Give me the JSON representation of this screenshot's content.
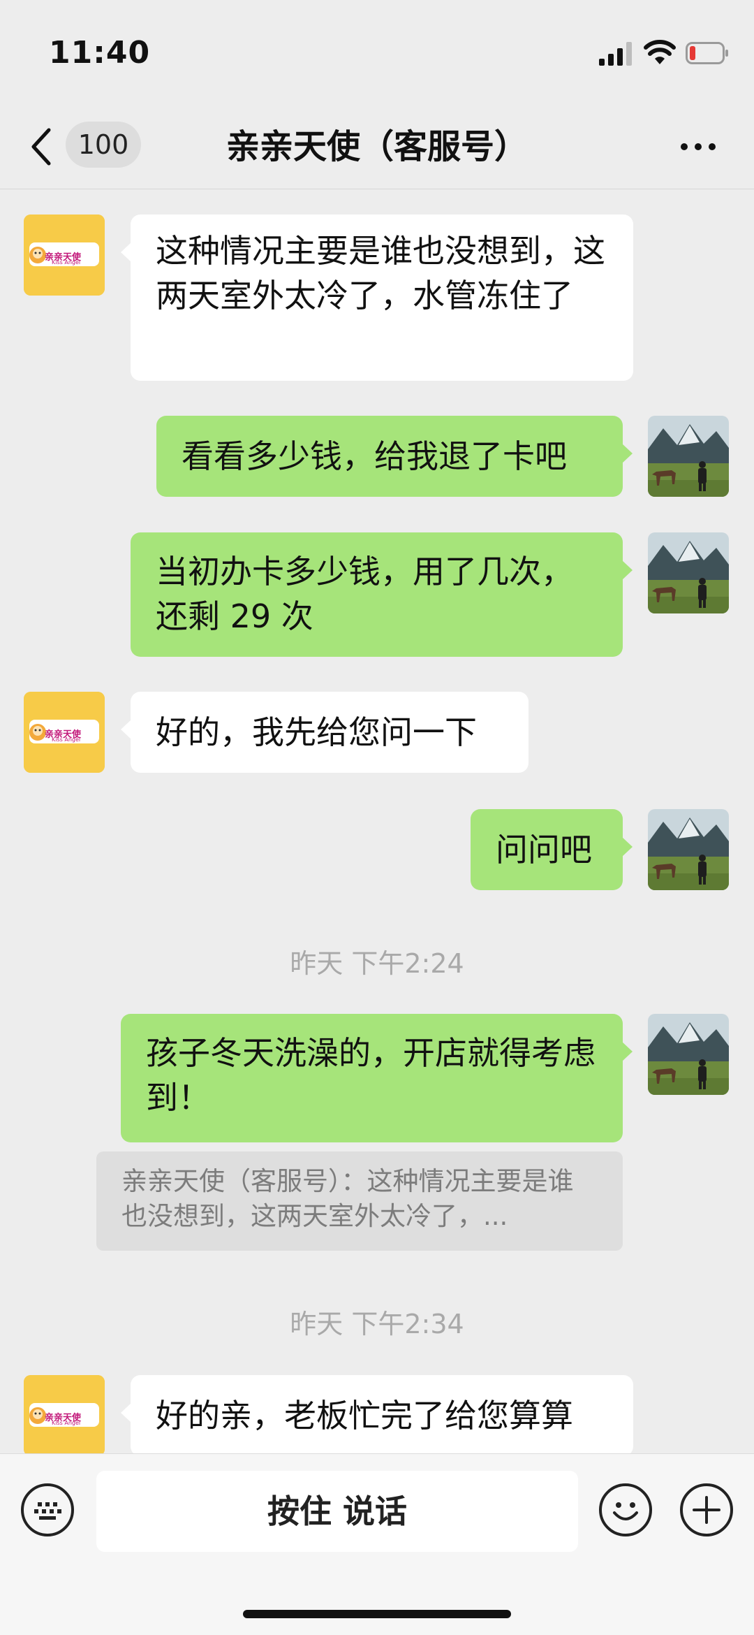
{
  "status_bar": {
    "time": "11:40"
  },
  "nav": {
    "unread_count": "100",
    "title": "亲亲天使（客服号）"
  },
  "brand_logo": {
    "text_cn": "亲亲天使",
    "text_en": "Kiss Angel"
  },
  "messages": [
    {
      "side": "left",
      "text": "这种情况主要是谁也没想到，这两天室外太冷了，水管冻住了"
    },
    {
      "side": "right",
      "text": "看看多少钱，给我退了卡吧"
    },
    {
      "side": "right",
      "text": "当初办卡多少钱，用了几次，还剩 29 次"
    },
    {
      "side": "left",
      "text": "好的，我先给您问一下"
    },
    {
      "side": "right",
      "text": "问问吧"
    },
    {
      "side": "right",
      "text": "孩子冬天洗澡的，开店就得考虑到！"
    },
    {
      "side": "left",
      "text": "好的亲，老板忙完了给您算算"
    }
  ],
  "timestamps": [
    "昨天 下午2:24",
    "昨天 下午2:34"
  ],
  "quote": {
    "text": "亲亲天使（客服号）：这种情况主要是谁也没想到，这两天室外太冷了，..."
  },
  "input_bar": {
    "voice_label": "按住 说话"
  },
  "colors": {
    "background": "#ededed",
    "self_bubble": "#a6e47a",
    "other_bubble": "#ffffff",
    "brand_avatar": "#f7cb48"
  }
}
